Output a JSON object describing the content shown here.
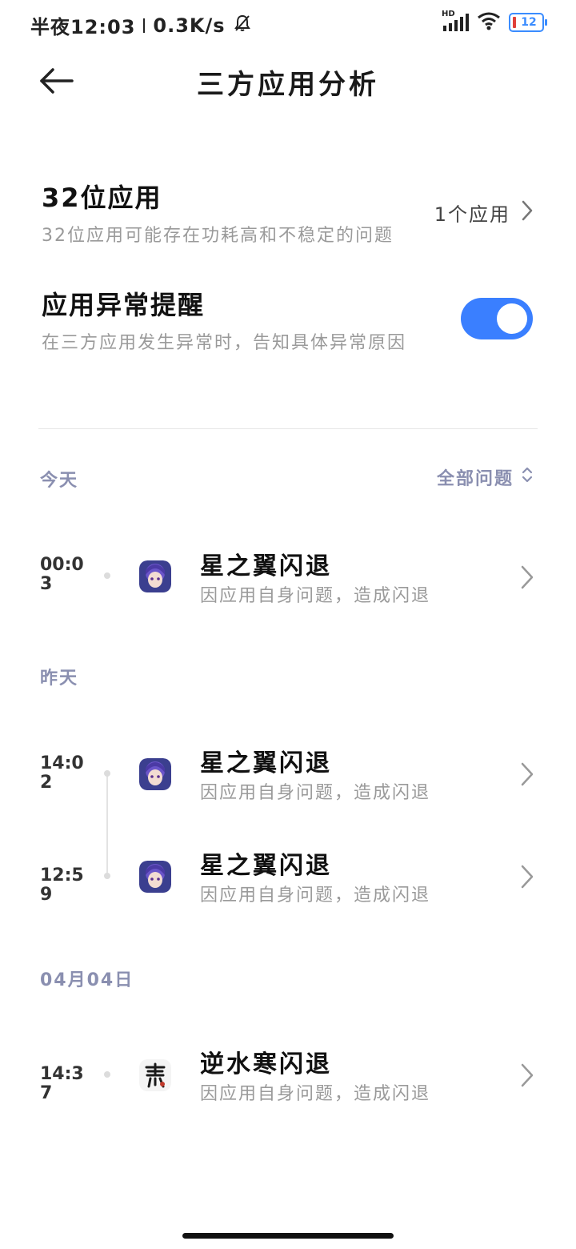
{
  "status_bar": {
    "time": "半夜12:03",
    "net_speed": "0.3K/s",
    "hd_label": "HD",
    "battery_level": "12"
  },
  "header": {
    "title": "三方应用分析"
  },
  "app32": {
    "title": "32位应用",
    "desc": "32位应用可能存在功耗高和不稳定的问题",
    "count": "1个应用"
  },
  "alert": {
    "title": "应用异常提醒",
    "desc": "在三方应用发生异常时，告知具体异常原因",
    "enabled": true
  },
  "filter": {
    "label": "全部问题"
  },
  "sections": {
    "today": "今天",
    "yesterday": "昨天",
    "apr4": "04月04日"
  },
  "events": [
    {
      "time": "00:03",
      "title": "星之翼闪退",
      "desc": "因应用自身问题，造成闪退"
    },
    {
      "time": "14:02",
      "title": "星之翼闪退",
      "desc": "因应用自身问题，造成闪退"
    },
    {
      "time": "12:59",
      "title": "星之翼闪退",
      "desc": "因应用自身问题，造成闪退"
    },
    {
      "time": "14:37",
      "title": "逆水寒闪退",
      "desc": "因应用自身问题，造成闪退"
    }
  ],
  "icons": {
    "back": "arrow-left-icon",
    "chevron": "chevron-right-icon",
    "sort": "chevron-up-down-icon",
    "mute": "bell-off-icon",
    "signal": "signal-icon",
    "wifi": "wifi-icon",
    "battery": "battery-icon"
  },
  "colors": {
    "accent": "#3a7fff",
    "section_label": "#8a8fb0",
    "muted_text": "#9a9a9a",
    "battery": "#3a8cff",
    "battery_low": "#e0403a"
  }
}
